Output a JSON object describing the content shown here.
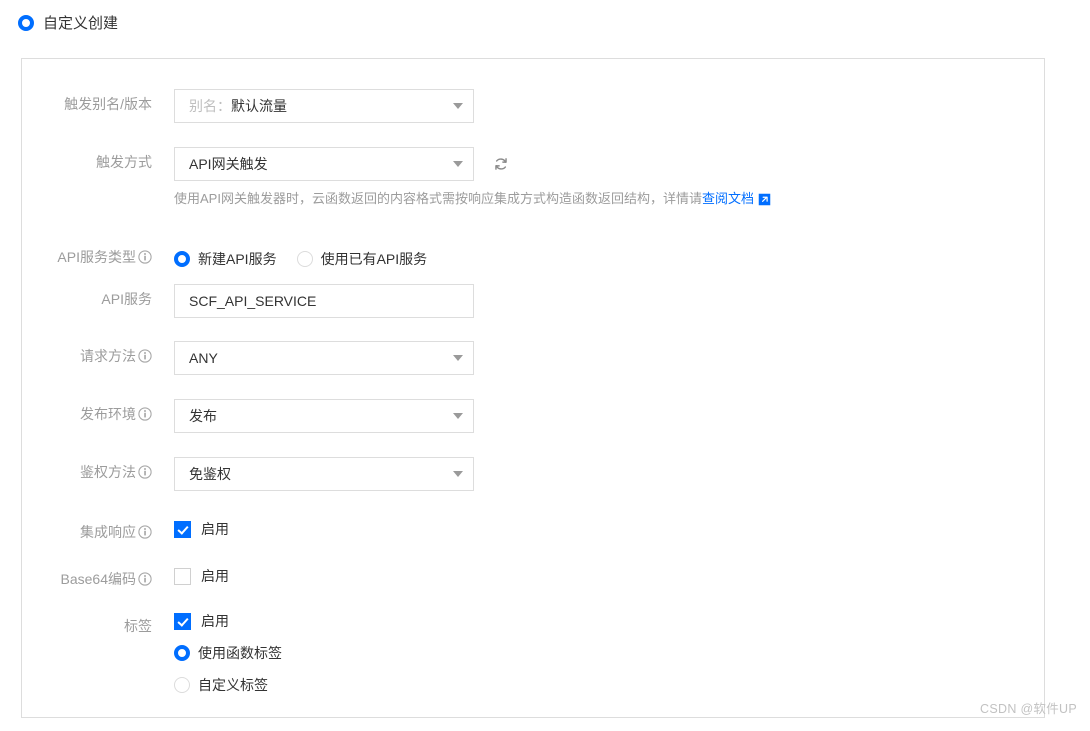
{
  "top_choice": {
    "label": "自定义创建",
    "selected": true,
    "icon": "radio-selected-icon"
  },
  "accent_color": "#006eff",
  "label_color": "#9c9c9c",
  "form": {
    "rows": [
      {
        "key": "trigger_alias",
        "label": "触发别名/版本",
        "has_info": false,
        "control": "select",
        "placeholder": "别名：",
        "value": "默认流量"
      },
      {
        "key": "trigger_method",
        "label": "触发方式",
        "has_info": false,
        "control": "select",
        "value": "API网关触发",
        "refresh_icon": "refresh-icon",
        "help": {
          "text": "使用API网关触发器时，云函数返回的内容格式需按响应集成方式构造函数返回结构，详情请",
          "link_text": "查阅文档",
          "link_icon": "external-link-icon"
        }
      },
      {
        "key": "api_service_type",
        "label": "API服务类型",
        "has_info": true,
        "control": "radio-group",
        "options": [
          {
            "label": "新建API服务",
            "selected": true
          },
          {
            "label": "使用已有API服务",
            "selected": false
          }
        ]
      },
      {
        "key": "api_service",
        "label": "API服务",
        "has_info": false,
        "control": "text",
        "value": "SCF_API_SERVICE"
      },
      {
        "key": "request_method",
        "label": "请求方法",
        "has_info": true,
        "control": "select",
        "value": "ANY"
      },
      {
        "key": "release_env",
        "label": "发布环境",
        "has_info": true,
        "control": "select",
        "value": "发布"
      },
      {
        "key": "auth_method",
        "label": "鉴权方法",
        "has_info": true,
        "control": "select",
        "value": "免鉴权"
      },
      {
        "key": "integrated_response",
        "label": "集成响应",
        "has_info": true,
        "control": "checkbox",
        "checkbox_label": "启用",
        "checked": true
      },
      {
        "key": "base64_encoding",
        "label": "Base64编码",
        "has_info": true,
        "control": "checkbox",
        "checkbox_label": "启用",
        "checked": false
      },
      {
        "key": "tags",
        "label": "标签",
        "has_info": false,
        "control": "checkbox-with-radios",
        "checkbox_label": "启用",
        "checked": true,
        "options": [
          {
            "label": "使用函数标签",
            "selected": true
          },
          {
            "label": "自定义标签",
            "selected": false
          }
        ]
      }
    ]
  },
  "watermark": "CSDN @软件UP"
}
